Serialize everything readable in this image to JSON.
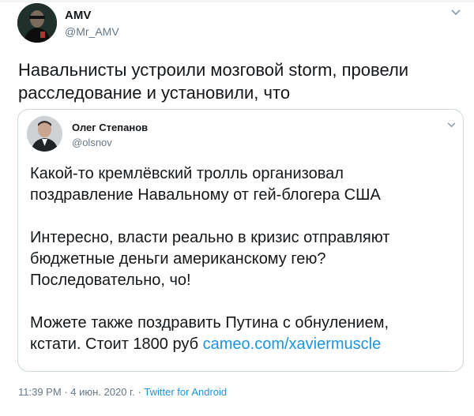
{
  "tweet": {
    "author": {
      "name": "AMV",
      "handle": "@Mr_AMV",
      "avatar_icon": "user-avatar"
    },
    "menu_icon": "chevron-down-icon",
    "text": "Навальнисты устроили мозговой storm, провели расследование и установили, что",
    "quoted": {
      "author": {
        "name": "Олег Степанов",
        "handle": "@olsnov",
        "avatar_icon": "user-avatar"
      },
      "menu_icon": "chevron-down-icon",
      "paragraphs": [
        [
          "Какой-то кремлёвский тролль организовал",
          "поздравление Навальному от гей-блогера США"
        ],
        [
          "Интересно, власти реально в кризис отправляют",
          "бюджетные деньги американскому гею?",
          "Последовательно, чо!"
        ],
        [
          "Можете также поздравить Путина с обнулением,"
        ]
      ],
      "last_line_prefix": "кстати. Стоит 1800 руб ",
      "link": "cameo.com/xaviermuscle"
    },
    "meta": {
      "time": "11:39 PM",
      "separator": " · ",
      "date": "4 июн. 2020 г.",
      "source": "Twitter for Android"
    },
    "colors": {
      "text": "#14171a",
      "secondary": "#657786",
      "link": "#1b95e0",
      "border": "#ccd6dd"
    }
  }
}
